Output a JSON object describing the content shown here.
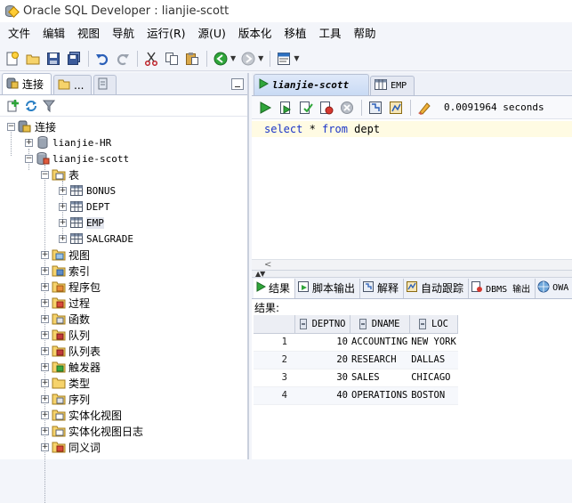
{
  "window": {
    "title": "Oracle SQL Developer : lianjie-scott"
  },
  "menu": [
    "文件",
    "编辑",
    "视图",
    "导航",
    "运行(R)",
    "源(U)",
    "版本化",
    "移植",
    "工具",
    "帮助"
  ],
  "left_panel": {
    "tabs": [
      "连接",
      "..."
    ],
    "tree": {
      "root": "连接",
      "connections": [
        "lianjie-HR",
        "lianjie-scott"
      ],
      "tables_node": "表",
      "tables": [
        "BONUS",
        "DEPT",
        "EMP",
        "SALGRADE"
      ],
      "categories": [
        "视图",
        "索引",
        "程序包",
        "过程",
        "函数",
        "队列",
        "队列表",
        "触发器",
        "类型",
        "序列",
        "实体化视图",
        "实体化视图日志",
        "同义词"
      ]
    }
  },
  "editor": {
    "tabs": [
      "lianjie-scott",
      "EMP"
    ],
    "exec_time": "0.0091964 seconds",
    "sql": {
      "kw1": "select",
      "mid": " * ",
      "kw2": "from",
      "rest": " dept"
    }
  },
  "results": {
    "tabs": [
      "结果",
      "脚本输出",
      "解释",
      "自动跟踪",
      "DBMS 输出",
      "OWA"
    ],
    "label": "结果:",
    "columns": [
      "DEPTNO",
      "DNAME",
      "LOC"
    ],
    "rows": [
      [
        "1",
        "10",
        "ACCOUNTING",
        "NEW YORK"
      ],
      [
        "2",
        "20",
        "RESEARCH",
        "DALLAS"
      ],
      [
        "3",
        "30",
        "SALES",
        "CHICAGO"
      ],
      [
        "4",
        "40",
        "OPERATIONS",
        "BOSTON"
      ]
    ]
  },
  "icons": [
    "new-icon",
    "open-icon",
    "save-icon",
    "save-all-icon",
    "undo-icon",
    "redo-icon",
    "cut-icon",
    "copy-icon",
    "paste-icon",
    "back-icon",
    "forward-icon",
    "sql-worksheet-icon"
  ]
}
